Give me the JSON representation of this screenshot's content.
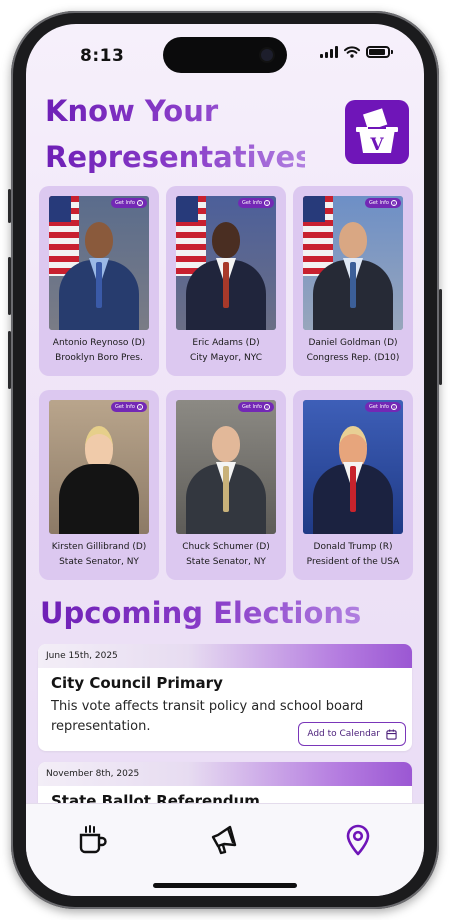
{
  "status": {
    "time": "8:13"
  },
  "header": {
    "title_line1": "Know Your",
    "title_line2": "Representatives",
    "logo_letter": "V"
  },
  "get_info_label": "Get Info",
  "representatives": [
    {
      "line1": "Antonio Reynoso (D)",
      "line2": "Brooklyn Boro Pres."
    },
    {
      "line1": "Eric Adams (D)",
      "line2": "City Mayor, NYC"
    },
    {
      "line1": "Daniel Goldman (D)",
      "line2": "Congress Rep. (D10)"
    },
    {
      "line1": "Kirsten Gillibrand (D)",
      "line2": "State Senator, NY"
    },
    {
      "line1": "Chuck Schumer (D)",
      "line2": "State Senator, NY"
    },
    {
      "line1": "Donald Trump (R)",
      "line2": "President of the USA"
    }
  ],
  "elections": {
    "heading": "Upcoming Elections",
    "items": [
      {
        "date": "June 15th, 2025",
        "name": "City Council Primary",
        "description": "This vote affects transit policy and school board representation.",
        "add_label": "Add to Calendar"
      },
      {
        "date": "November 8th, 2025",
        "name": "State Ballot Referendum"
      }
    ]
  },
  "tabbar": {
    "tabs": [
      "coffee-icon",
      "megaphone-icon",
      "location-pin-icon"
    ],
    "active_color": "#6f15b8"
  },
  "colors": {
    "accent": "#6f15b8",
    "card_bg": "#dcc8f0"
  }
}
